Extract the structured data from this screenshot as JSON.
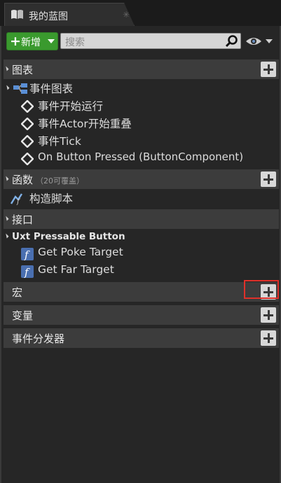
{
  "tab": {
    "title": "我的蓝图",
    "close": "✳"
  },
  "toolbar": {
    "new_label": "新增",
    "search_placeholder": "搜索"
  },
  "sections": {
    "graphs": {
      "title": "图表"
    },
    "event_graph": {
      "title": "事件图表"
    },
    "events": [
      "事件开始运行",
      "事件Actor开始重叠",
      "事件Tick",
      "On Button Pressed (ButtonComponent)"
    ],
    "functions": {
      "title": "函数",
      "count": "（20可覆盖）"
    },
    "construct": "构造脚本",
    "interfaces": {
      "title": "接口"
    },
    "uxt": {
      "title": "Uxt Pressable Button",
      "items": [
        "Get Poke Target",
        "Get Far Target"
      ]
    },
    "macros": {
      "title": "宏"
    },
    "variables": {
      "title": "变量"
    },
    "dispatchers": {
      "title": "事件分发器"
    }
  },
  "colors": {
    "add_button_green": "#3a9a2e",
    "highlight": "#e0302a"
  }
}
